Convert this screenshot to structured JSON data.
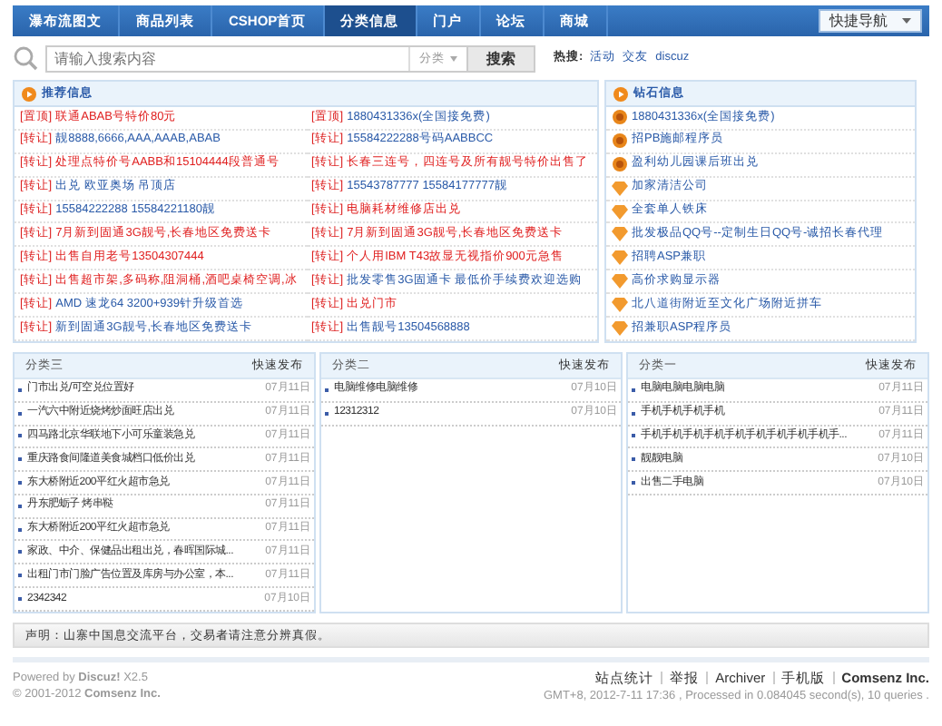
{
  "nav": {
    "items": [
      {
        "label": "瀑布流图文",
        "selected": false
      },
      {
        "label": "商品列表",
        "selected": false
      },
      {
        "label": "CSHOP首页",
        "selected": false
      },
      {
        "label": "分类信息",
        "selected": true
      },
      {
        "label": "门户",
        "selected": false
      },
      {
        "label": "论坛",
        "selected": false
      },
      {
        "label": "商城",
        "selected": false
      }
    ],
    "quick_nav": "快捷导航"
  },
  "search": {
    "placeholder": "请输入搜索内容",
    "category": "分类",
    "button": "搜索",
    "hot_label": "热搜:",
    "hot_words": [
      "活动",
      "交友",
      "discuz"
    ]
  },
  "recommended": {
    "title": "推荐信息",
    "columns": [
      [
        {
          "tag": "[置顶]",
          "title": "联通ABAB号特价80元",
          "highlight": true
        },
        {
          "tag": "[转让]",
          "title": "靓8888,6666,AAA,AAAB,ABAB",
          "highlight": false
        },
        {
          "tag": "[转让]",
          "title": "处理点特价号AABB和15104444段普通号",
          "highlight": true
        },
        {
          "tag": "[转让]",
          "title": "出兑 欧亚奥场 吊顶店",
          "highlight": false
        },
        {
          "tag": "[转让]",
          "title": "15584222288 15584221180靓",
          "highlight": false
        },
        {
          "tag": "[转让]",
          "title": "7月新到固通3G靓号,长春地区免费送卡",
          "highlight": true
        },
        {
          "tag": "[转让]",
          "title": "出售自用老号13504307444",
          "highlight": true
        },
        {
          "tag": "[转让]",
          "title": "出售超市架,多码称,阻洞桶,酒吧桌椅空调,冰",
          "highlight": true
        },
        {
          "tag": "[转让]",
          "title": "AMD 速龙64 3200+939针升级首选",
          "highlight": false
        },
        {
          "tag": "[转让]",
          "title": "新到固通3G靓号,长春地区免费送卡",
          "highlight": false
        }
      ],
      [
        {
          "tag": "[置顶]",
          "title": "1880431336x(全国接免费)",
          "highlight": false
        },
        {
          "tag": "[转让]",
          "title": "15584222288号码AABBCC",
          "highlight": false
        },
        {
          "tag": "[转让]",
          "title": "长春三连号，四连号及所有靓号特价出售了",
          "highlight": true
        },
        {
          "tag": "[转让]",
          "title": "15543787777 15584177777靓",
          "highlight": false
        },
        {
          "tag": "[转让]",
          "title": "电脑耗材维修店出兑",
          "highlight": true
        },
        {
          "tag": "[转让]",
          "title": "7月新到固通3G靓号,长春地区免费送卡",
          "highlight": true
        },
        {
          "tag": "[转让]",
          "title": "个人用IBM T43故显无视指价900元急售",
          "highlight": true
        },
        {
          "tag": "[转让]",
          "title": "批发零售3G固通卡 最低价手续费欢迎选购",
          "highlight": false
        },
        {
          "tag": "[转让]",
          "title": "出兑门市",
          "highlight": true
        },
        {
          "tag": "[转让]",
          "title": "出售靓号13504568888",
          "highlight": false
        }
      ]
    ]
  },
  "diamond": {
    "title": "钻石信息",
    "items": [
      {
        "kind": "top",
        "title": "1880431336x(全国接免费)"
      },
      {
        "kind": "top",
        "title": "招PB施邮程序员"
      },
      {
        "kind": "top",
        "title": "盈利幼儿园课后班出兑"
      },
      {
        "kind": "diamond",
        "title": "加家清洁公司"
      },
      {
        "kind": "diamond",
        "title": "全套单人铁床"
      },
      {
        "kind": "diamond",
        "title": "批发极品QQ号--定制生日QQ号-诚招长春代理"
      },
      {
        "kind": "diamond",
        "title": "招聘ASP兼职"
      },
      {
        "kind": "diamond",
        "title": "高价求购显示器"
      },
      {
        "kind": "diamond",
        "title": "北八道街附近至文化广场附近拼车"
      },
      {
        "kind": "diamond",
        "title": "招兼职ASP程序员"
      }
    ]
  },
  "categories": [
    {
      "title": "分类三",
      "post": "快速发布",
      "items": [
        {
          "title": "门市出兑/可空兑位置好",
          "date": "07月11日"
        },
        {
          "title": "一汽六中附近烧烤炒面旺店出兑",
          "date": "07月11日"
        },
        {
          "title": "四马路北京华联地下小可乐童装急兑",
          "date": "07月11日"
        },
        {
          "title": "重庆路食间隆道美食城档口低价出兑",
          "date": "07月11日"
        },
        {
          "title": "东大桥附近200平红火超市急兑",
          "date": "07月11日"
        },
        {
          "title": "丹东肥蛎子 烤串鞑",
          "date": "07月11日"
        },
        {
          "title": "东大桥附近200平红火超市急兑",
          "date": "07月11日"
        },
        {
          "title": "家政、中介、保健品出租出兑，春晖国际城...",
          "date": "07月11日"
        },
        {
          "title": "出租门市门脸广告位置及库房与办公室，本...",
          "date": "07月11日"
        },
        {
          "title": "2342342",
          "date": "07月10日"
        }
      ]
    },
    {
      "title": "分类二",
      "post": "快速发布",
      "items": [
        {
          "title": "电脑维修电脑维修",
          "date": "07月10日"
        },
        {
          "title": "12312312",
          "date": "07月10日"
        }
      ]
    },
    {
      "title": "分类一",
      "post": "快速发布",
      "items": [
        {
          "title": "电脑电脑电脑电脑",
          "date": "07月11日"
        },
        {
          "title": "手机手机手机手机",
          "date": "07月11日"
        },
        {
          "title": "手机手机手机手机手机手机手机手机手机手...",
          "date": "07月11日"
        },
        {
          "title": "靓靓电脑",
          "date": "07月10日"
        },
        {
          "title": "出售二手电脑",
          "date": "07月10日"
        }
      ]
    }
  ],
  "notice": "声明：山寨中国息交流平台，交易者请注意分辨真假。",
  "footer": {
    "powered": "Powered by **Discuz!** X2.5",
    "copyright": "© 2001-2012 **Comsenz Inc.**",
    "links": [
      {
        "label": "站点统计",
        "bold": false
      },
      {
        "label": "举报",
        "bold": false
      },
      {
        "label": "Archiver",
        "bold": false
      },
      {
        "label": "手机版",
        "bold": false
      },
      {
        "label": "Comsenz Inc.",
        "bold": true
      }
    ],
    "stats": "GMT+8, 2012-7-11 17:36 , Processed in 0.084045 second(s), 10 queries ."
  }
}
